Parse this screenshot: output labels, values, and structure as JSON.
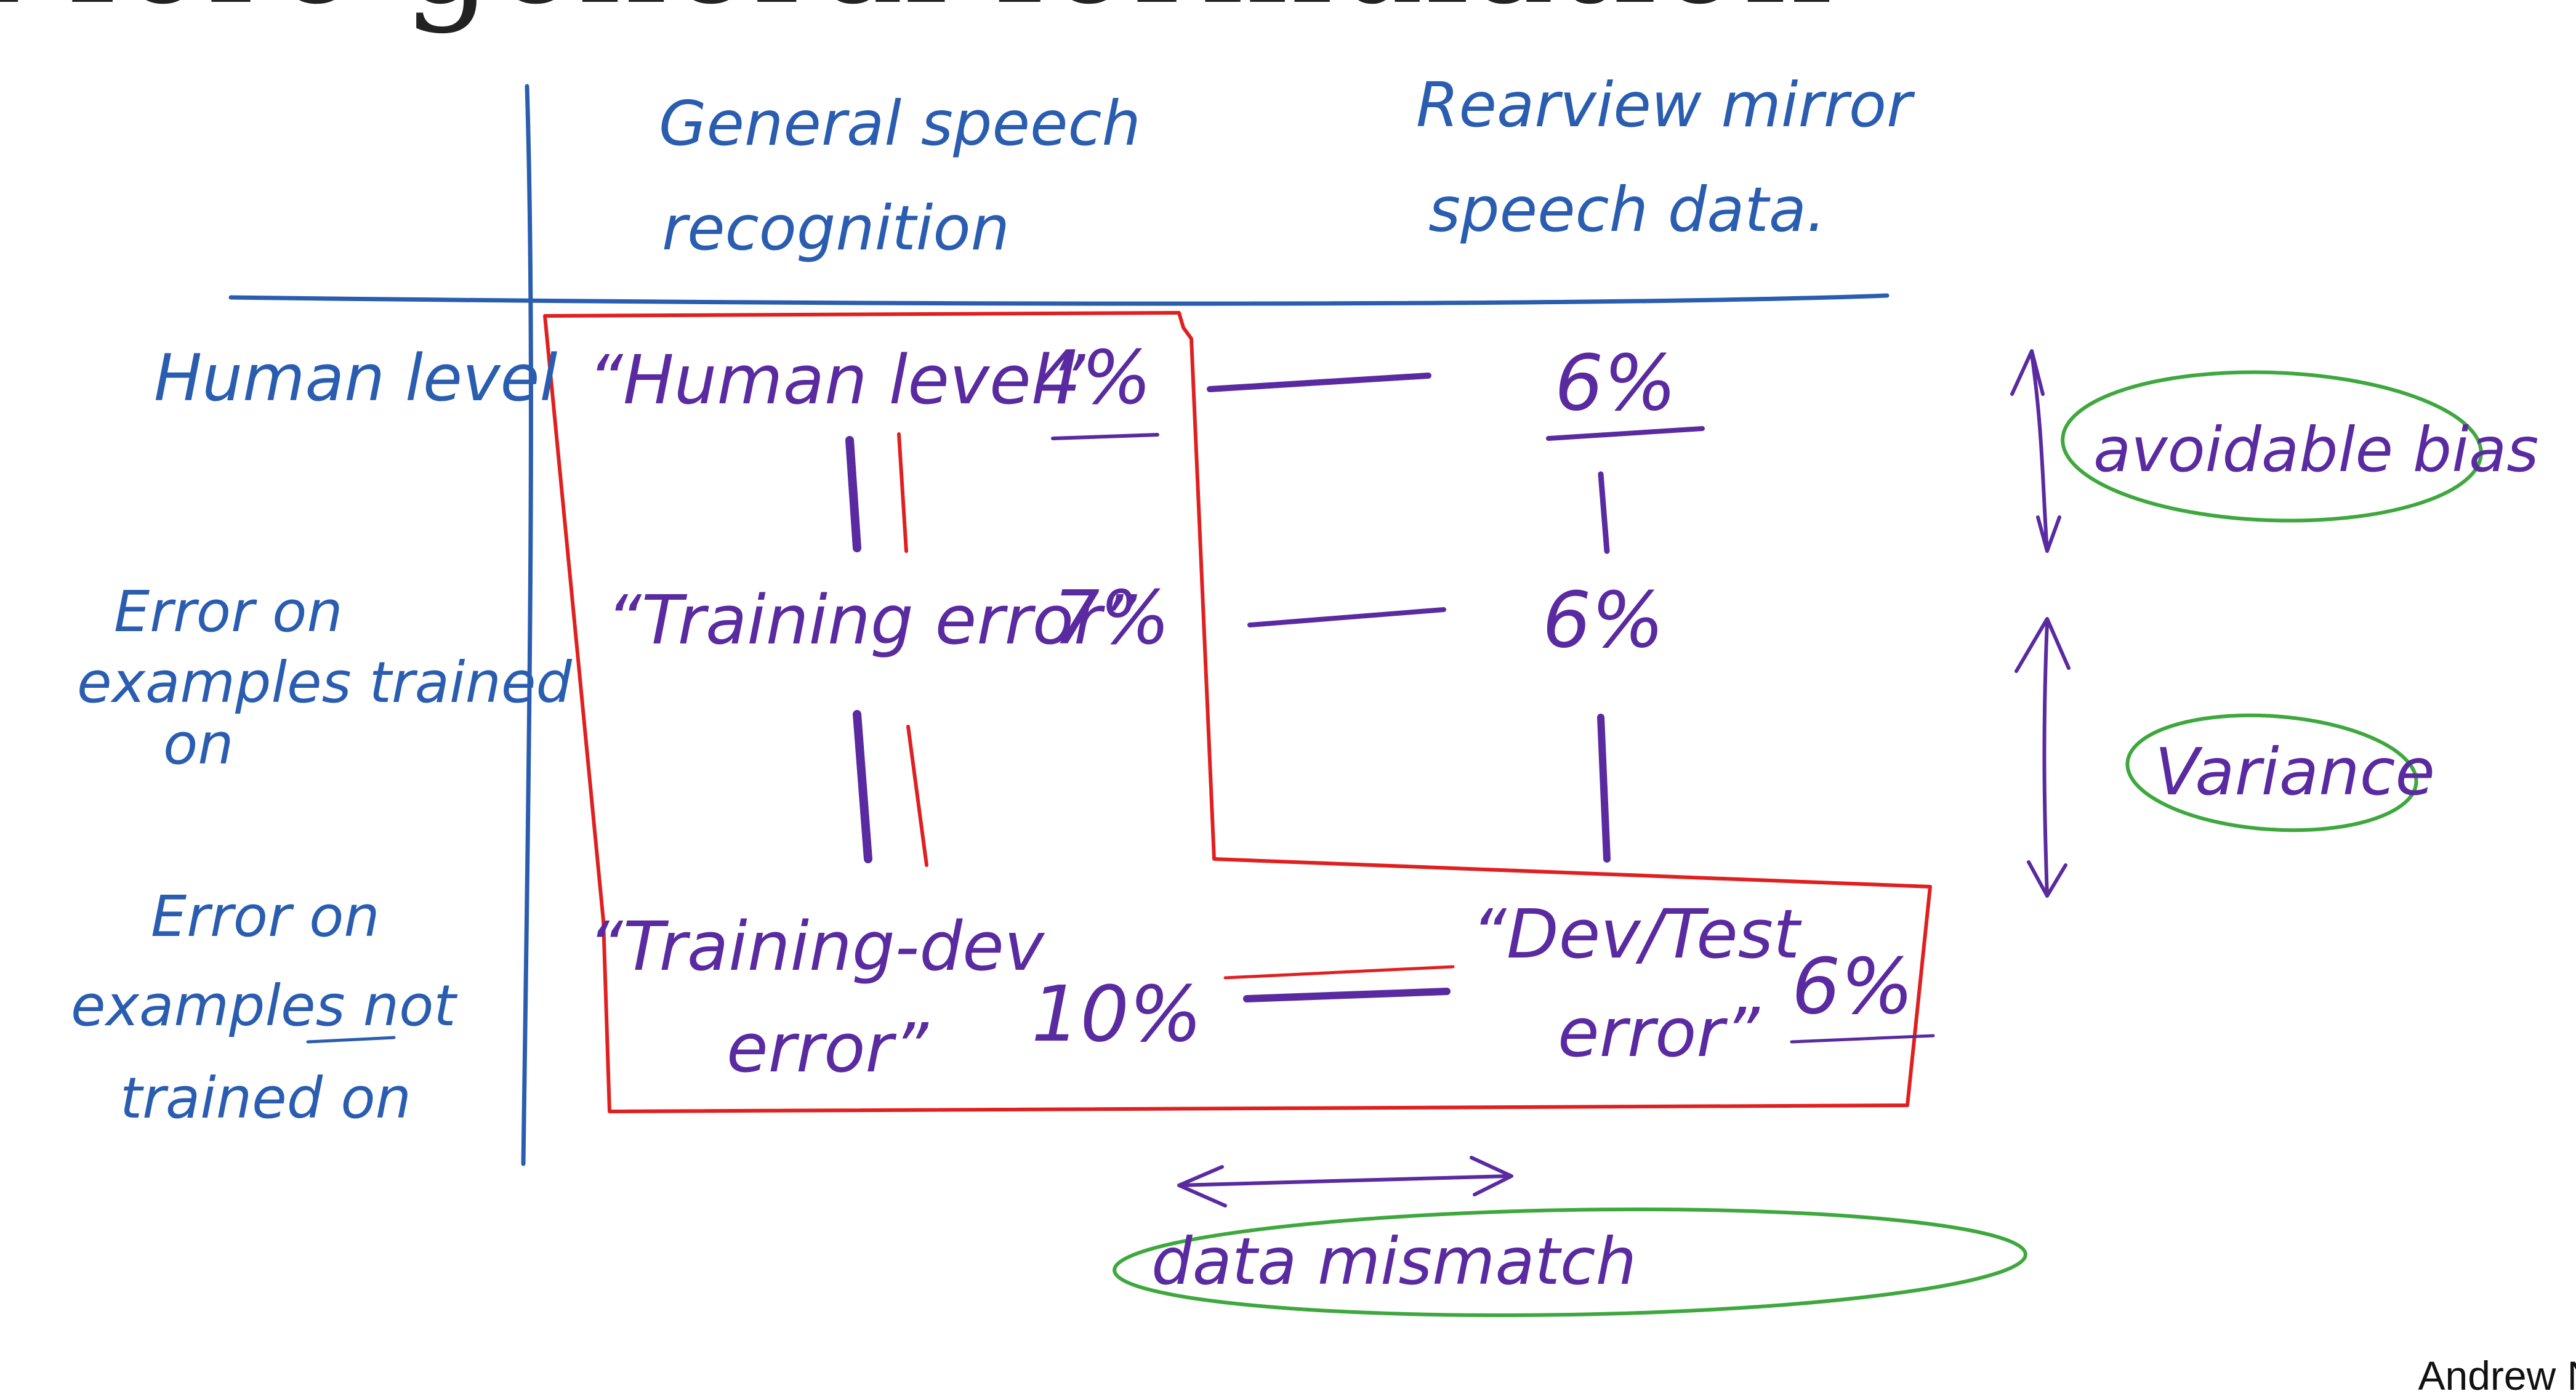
{
  "title": "More general formulation",
  "author": "Andrew Ng",
  "colors": {
    "grid": "#2a5db0",
    "values": "#5a2aa0",
    "highlight_box": "#e02020",
    "ovals": "#3ea83e"
  },
  "columns": {
    "general": [
      "General speech",
      "recognition"
    ],
    "rearview": [
      "Rearview mirror",
      "speech data."
    ]
  },
  "rows": {
    "human": [
      "Human level"
    ],
    "trained": [
      "Error on",
      "examples trained",
      "on"
    ],
    "not_trained": [
      "Error on",
      "examples not",
      "trained on"
    ]
  },
  "cells": {
    "general_human_label": "“Human level”",
    "general_human_value": "4%",
    "general_train_label": "“Training error”",
    "general_train_value": "7%",
    "general_dev_label": [
      "“Training-dev",
      "error”"
    ],
    "general_dev_value": "10%",
    "rear_human_value": "6%",
    "rear_train_value": "6%",
    "rear_test_label": [
      "“Dev/Test",
      "error”"
    ],
    "rear_test_value": "6%"
  },
  "annotations": {
    "avoidable_bias": "avoidable bias",
    "variance": "Variance",
    "data_mismatch": "data mismatch"
  }
}
